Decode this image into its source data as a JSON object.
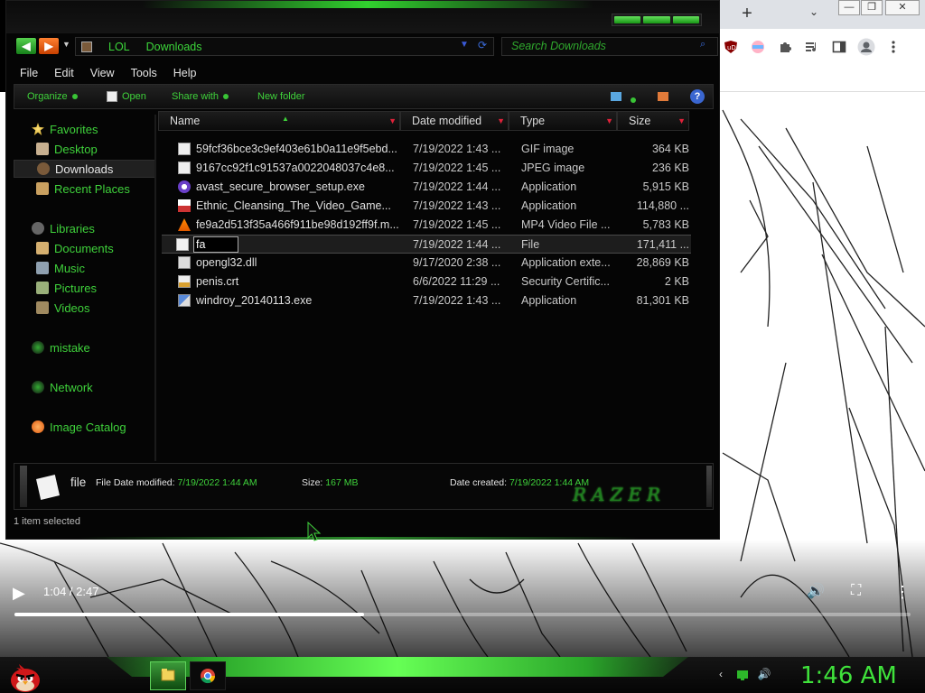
{
  "browser": {
    "new_tab_label": "+",
    "tab_menu_label": "⌄",
    "window_controls": [
      "—",
      "❐",
      "✕"
    ],
    "toolbar_icons": [
      "ublock-icon",
      "extension-colorful-icon",
      "puzzle-extensions-icon",
      "media-control-icon",
      "side-panel-icon",
      "profile-icon",
      "kebab-menu-icon"
    ]
  },
  "video": {
    "time": "1:04 / 2:47",
    "progress": 0.39,
    "play_icon": "▶",
    "volume_icon": "🔊",
    "fullscreen_icon": "⛶",
    "more_icon": "⋮"
  },
  "explorer": {
    "breadcrumb": [
      "LOL",
      "Downloads"
    ],
    "search_placeholder": "Search Downloads",
    "menu": [
      "File",
      "Edit",
      "View",
      "Tools",
      "Help"
    ],
    "commands": {
      "organize": "Organize",
      "open": "Open",
      "share_with": "Share with",
      "new_folder": "New folder",
      "help": "?"
    },
    "nav": {
      "favorites": "Favorites",
      "desktop": "Desktop",
      "downloads": "Downloads",
      "recent": "Recent Places",
      "libraries": "Libraries",
      "documents": "Documents",
      "music": "Music",
      "pictures": "Pictures",
      "videos": "Videos",
      "mistake": "mistake",
      "network": "Network",
      "image_catalog": "Image Catalog"
    },
    "columns": [
      "Name",
      "Date modified",
      "Type",
      "Size"
    ],
    "files": [
      {
        "name": "59fcf36bce3c9ef403e61b0a11e9f5ebd...",
        "date": "7/19/2022 1:43 ...",
        "type": "GIF image",
        "size": "364 KB",
        "icon": "image-file-icon"
      },
      {
        "name": "9167cc92f1c91537a0022048037c4e8...",
        "date": "7/19/2022 1:45 ...",
        "type": "JPEG image",
        "size": "236 KB",
        "icon": "image-file-icon"
      },
      {
        "name": "avast_secure_browser_setup.exe",
        "date": "7/19/2022 1:44 ...",
        "type": "Application",
        "size": "5,915 KB",
        "icon": "avast-icon"
      },
      {
        "name": "Ethnic_Cleansing_The_Video_Game...",
        "date": "7/19/2022 1:43 ...",
        "type": "Application",
        "size": "114,880 ...",
        "icon": "installer-icon"
      },
      {
        "name": "fe9a2d513f35a466f911be98d192ff9f.m...",
        "date": "7/19/2022 1:45 ...",
        "type": "MP4 Video File ...",
        "size": "5,783 KB",
        "icon": "vlc-icon"
      },
      {
        "name": "fa",
        "date": "7/19/2022 1:44 ...",
        "type": "File",
        "size": "171,411 ...",
        "icon": "blank-file-icon"
      },
      {
        "name": "opengl32.dll",
        "date": "9/17/2020 2:38 ...",
        "type": "Application exte...",
        "size": "28,869 KB",
        "icon": "dll-icon"
      },
      {
        "name": "penis.crt",
        "date": "6/6/2022 11:29 ...",
        "type": "Security Certific...",
        "size": "2 KB",
        "icon": "certificate-icon"
      },
      {
        "name": "windroy_20140113.exe",
        "date": "7/19/2022 1:43 ...",
        "type": "Application",
        "size": "81,301 KB",
        "icon": "setup-exe-icon"
      }
    ],
    "rename_value": "fa",
    "details": {
      "name": "file",
      "type": "File",
      "date_modified_label": "Date modified:",
      "date_modified": "7/19/2022 1:44 AM",
      "size_label": "Size:",
      "size": "167 MB",
      "date_created_label": "Date created:",
      "date_created": "7/19/2022 1:44 AM",
      "brand": "RAZER"
    },
    "status": "1 item selected"
  },
  "taskbar": {
    "clock": "1:46 AM",
    "apps": [
      "file-explorer-icon",
      "chrome-icon"
    ]
  },
  "colors": {
    "accent_green": "#3fd23b",
    "header_arrow_red": "#e0223a",
    "clock_green": "#3fe23b"
  }
}
